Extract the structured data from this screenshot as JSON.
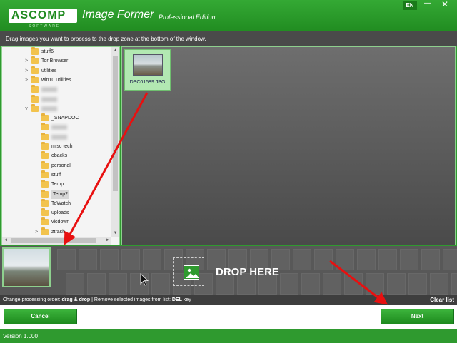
{
  "window": {
    "logo_text": "ASCOMP",
    "logo_sub": "SOFTWARE",
    "title": "Image Former",
    "edition": "Professional Edition",
    "language": "EN",
    "minimize_glyph": "—",
    "close_glyph": "✕"
  },
  "instruction": "Drag images you want to process to the drop zone at the bottom of the window.",
  "tree": {
    "items": [
      {
        "label": "stuff6",
        "indent": 1,
        "expander": "",
        "blurred": false
      },
      {
        "label": "Tor Browser",
        "indent": 1,
        "expander": ">",
        "blurred": false
      },
      {
        "label": "utilities",
        "indent": 1,
        "expander": ">",
        "blurred": false
      },
      {
        "label": "win10 utilities",
        "indent": 1,
        "expander": ">",
        "blurred": false
      },
      {
        "label": "",
        "indent": 1,
        "expander": "",
        "blurred": true
      },
      {
        "label": "",
        "indent": 1,
        "expander": "",
        "blurred": true
      },
      {
        "label": "",
        "indent": 1,
        "expander": "v",
        "blurred": true
      },
      {
        "label": "_SNAPDOC",
        "indent": 2,
        "expander": "",
        "blurred": false
      },
      {
        "label": "",
        "indent": 2,
        "expander": "",
        "blurred": true
      },
      {
        "label": "",
        "indent": 2,
        "expander": "",
        "blurred": true
      },
      {
        "label": "misc tech",
        "indent": 2,
        "expander": "",
        "blurred": false
      },
      {
        "label": "obacks",
        "indent": 2,
        "expander": "",
        "blurred": false
      },
      {
        "label": "personal",
        "indent": 2,
        "expander": "",
        "blurred": false
      },
      {
        "label": "stuff",
        "indent": 2,
        "expander": "",
        "blurred": false
      },
      {
        "label": "Temp",
        "indent": 2,
        "expander": "",
        "blurred": false
      },
      {
        "label": "Temp2",
        "indent": 2,
        "expander": "",
        "blurred": false,
        "selected": true
      },
      {
        "label": "ToWatch",
        "indent": 2,
        "expander": "",
        "blurred": false
      },
      {
        "label": "uploads",
        "indent": 2,
        "expander": "",
        "blurred": false
      },
      {
        "label": "vlcdown",
        "indent": 2,
        "expander": "",
        "blurred": false
      },
      {
        "label": "ztrash",
        "indent": 2,
        "expander": ">",
        "blurred": false
      }
    ],
    "scroll_up": "▲",
    "scroll_down": "▼",
    "scroll_left": "◄",
    "scroll_right": "►"
  },
  "files": [
    {
      "name": "DSC01589.JPG"
    }
  ],
  "dropzone": {
    "label": "DROP HERE"
  },
  "hint": {
    "order_prefix": "Change processing order:",
    "order_action": "drag & drop",
    "remove_prefix": "| Remove selected images from list:",
    "remove_key": "DEL",
    "remove_suffix": "key",
    "clear_list": "Clear list"
  },
  "buttons": {
    "cancel": "Cancel",
    "next": "Next"
  },
  "status": {
    "version": "Version 1.000"
  },
  "colors": {
    "brand_green": "#2f9a2f",
    "annotation_red": "#e81010"
  }
}
